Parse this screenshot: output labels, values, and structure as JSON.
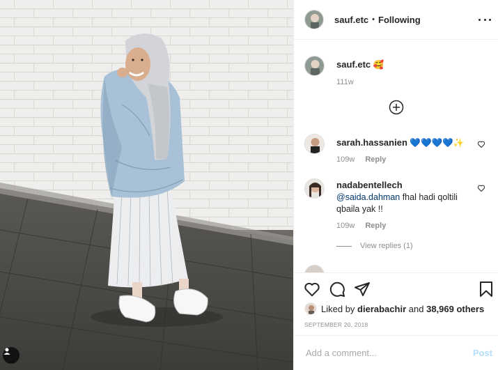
{
  "post": {
    "photo_alt_icon": "user-tag-icon"
  },
  "header": {
    "username": "sauf.etc",
    "separator": "•",
    "follow_status": "Following",
    "more_icon": "more-horizontal-icon"
  },
  "caption": {
    "username": "sauf.etc",
    "text": "🥰",
    "time": "111w"
  },
  "load_more_icon": "plus-circle-icon",
  "comments": [
    {
      "username": "sarah.hassanien",
      "text": "💙💙💙💙✨",
      "time": "109w",
      "reply_label": "Reply"
    },
    {
      "username": "nadabentellech",
      "mention": "@saida.dahman",
      "text": " fhal hadi qoltili qbaila yak !!",
      "time": "109w",
      "reply_label": "Reply",
      "view_replies": "View replies (1)"
    }
  ],
  "actions": {
    "like_icon": "heart-icon",
    "comment_icon": "comment-icon",
    "share_icon": "send-icon",
    "save_icon": "bookmark-icon"
  },
  "likes": {
    "prefix": "Liked by ",
    "user": "dierabachir",
    "middle": " and ",
    "count": "38,969 others"
  },
  "date": "SEPTEMBER 20, 2018",
  "add_comment": {
    "placeholder": "Add a comment...",
    "post_label": "Post"
  },
  "colors": {
    "link": "#00376b",
    "muted": "#8e8e8e",
    "post_disabled": "#b2dffc",
    "heart_emoji": "#1877f2"
  }
}
